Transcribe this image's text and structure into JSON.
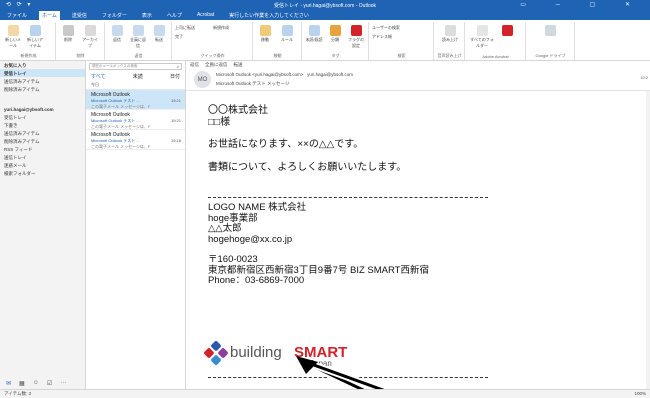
{
  "titlebar": {
    "title": "受信トレイ - yuri.hagai@ybsoft.com - Outlook"
  },
  "tabs": [
    "ファイル",
    "ホーム",
    "送受信",
    "フォルダー",
    "表示",
    "ヘルプ",
    "Acrobat",
    "実行したい作業を入力してください"
  ],
  "active_tab": "ホーム",
  "ribbon": {
    "groups": [
      {
        "label": "新規作成",
        "buttons": [
          "新しいメール",
          "新しいアイテム"
        ]
      },
      {
        "label": "削除",
        "buttons": [
          "削除",
          "アーカイブ"
        ]
      },
      {
        "label": "返信",
        "buttons": [
          "返信",
          "全員に返信",
          "転送"
        ]
      },
      {
        "label": "クイック操作",
        "buttons": [
          "上司に転送",
          "完了",
          "新規作成"
        ]
      },
      {
        "label": "移動",
        "buttons": [
          "移動",
          "ルール"
        ]
      },
      {
        "label": "タグ",
        "buttons": [
          "未読/既読",
          "分類",
          "フラグの設定"
        ]
      },
      {
        "label": "検索",
        "buttons": [
          "ユーザーの検索",
          "アドレス帳"
        ]
      },
      {
        "label": "音声読み上げ",
        "buttons": [
          "読み上げ"
        ]
      },
      {
        "label": "Adobe Acrobat",
        "buttons": [
          "すべてのフォルダー"
        ]
      },
      {
        "label": "Google ドライブ",
        "buttons": [
          "Google ドライブ"
        ]
      }
    ]
  },
  "navpane": {
    "favorites": "お気に入り",
    "items": [
      "受信トレイ",
      "送信済みアイテム",
      "削除済みアイテム"
    ],
    "account": "yuri.hagai@ybsoft.com",
    "account_items": [
      "受信トレイ",
      "下書き",
      "送信済みアイテム",
      "削除済みアイテム",
      "RSS フィード",
      "送信トレイ",
      "迷惑メール",
      "検索フォルダー"
    ]
  },
  "msglist": {
    "search_placeholder": "現在のメールボックスの検索",
    "filter_all": "すべて",
    "filter_unread": "未読",
    "sort": "日付",
    "group": "今日",
    "messages": [
      {
        "sender": "Microsoft Outlook",
        "subject": "Microsoft Outlook テスト ...",
        "preview": "この電子メール メッセージは、F",
        "time": "19:21",
        "selected": true
      },
      {
        "sender": "Microsoft Outlook",
        "subject": "Microsoft Outlook テスト ...",
        "preview": "この電子メール メッセージは、F",
        "time": "19:21",
        "selected": false
      },
      {
        "sender": "Microsoft Outlook",
        "subject": "Microsoft Outlook テスト ...",
        "preview": "この電子メール メッセージは、F",
        "time": "19:18",
        "selected": false
      }
    ]
  },
  "reading": {
    "tools": [
      "返信",
      "全員に返信",
      "転送"
    ],
    "avatar": "MO",
    "from": "Microsoft Outlook <yuri.hagai@ybsoft.com>",
    "to": "yuri.hagai@ybsoft.com",
    "subject": "Microsoft Outlook テスト メッセージ",
    "date": "19:2",
    "body": {
      "line1": "〇〇株式会社",
      "line2": "□□様",
      "line3": "お世話になります、××の△△です。",
      "line4": "書類について、よろしくお願いいたします。",
      "sig1": "LOGO NAME 株式会社",
      "sig2": "hoge事業部",
      "sig3": "△△太郎",
      "sig4": "hogehoge@xx.co.jp",
      "sig5": "〒160-0023",
      "sig6": "東京都新宿区西新宿3丁目9番7号 BIZ SMART西新宿",
      "sig7": "Phone：03-6869-7000"
    },
    "logo_text_left": "building",
    "logo_text_right": "SMART",
    "logo_sub": "Japan"
  },
  "statusbar": {
    "left": "アイテム数: 3",
    "zoom": "100%"
  },
  "colors": {
    "accent": "#1f63b4",
    "selection": "#cde6f7",
    "logo_red": "#d2232a"
  }
}
